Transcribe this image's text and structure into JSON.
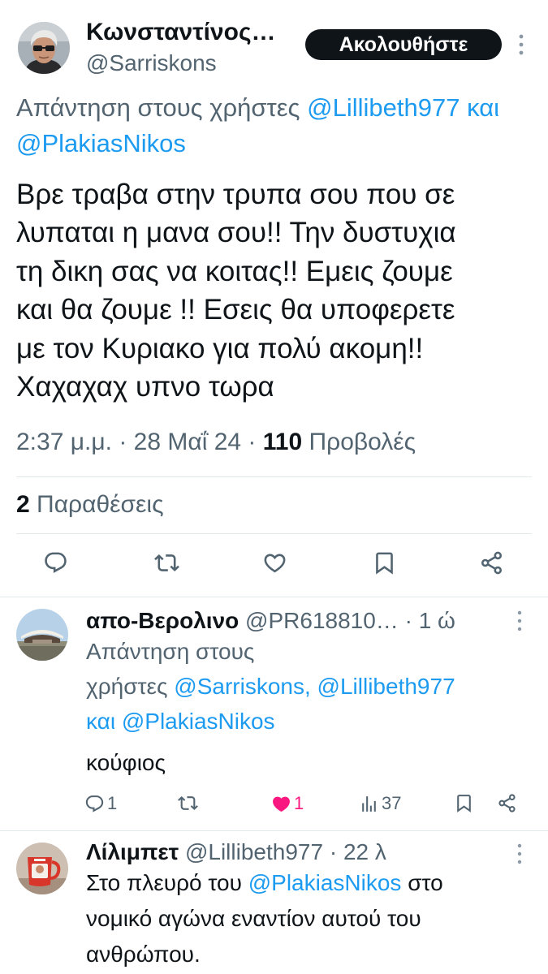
{
  "theme": {
    "text": "#0f1419",
    "secondary": "#536471",
    "link": "#1d9bf0",
    "like": "#f91880",
    "divider": "#e3e8eb",
    "follow_button_bg": "#0f1419"
  },
  "main_tweet": {
    "author": {
      "name": "Κωνσταντίνος…",
      "handle": "@Sarriskons",
      "avatar_icon": "avatar-photo"
    },
    "follow_button": "Ακολουθήστε",
    "more_icon": "more-vertical-icon",
    "reply_to": {
      "prefix": "Απάντηση στους χρήστες",
      "mention_1": "@Lillibeth977",
      "conjunction": "και",
      "mention_2": "@PlakiasNikos"
    },
    "text_lines": [
      "Βρε τραβα στην τρυπα σου που σε",
      "λυπαται η μανα σου!! Την δυστυχια",
      "τη δικη σας να κοιτας!! Εμεις ζουμε",
      "και θα ζουμε !! Εσεις θα υποφερετε",
      "με τον Κυριακο για πολύ ακομη!!",
      "Χαχαχαχ υπνο τωρα"
    ],
    "meta": {
      "time": "2:37 μ.μ.",
      "separator": "·",
      "date": "28 Μαΐ 24",
      "views_count": "110",
      "views_label": "Προβολές"
    },
    "quotes": {
      "count": "2",
      "label": "Παραθέσεις"
    },
    "actions": [
      {
        "icon": "reply-icon"
      },
      {
        "icon": "retweet-icon"
      },
      {
        "icon": "like-icon"
      },
      {
        "icon": "bookmark-icon"
      },
      {
        "icon": "share-icon"
      }
    ]
  },
  "replies": [
    {
      "name": "απο-Βερολινο",
      "handle": "@PR618810…",
      "separator": "·",
      "time": "1 ώ",
      "avatar_icon": "avatar-landscape",
      "reply_to": {
        "line1": "Απάντηση στους",
        "line2_prefix": "χρήστες",
        "mention_1": "@Sarriskons",
        "comma": ",",
        "mention_2": "@Lillibeth977",
        "conjunction": "και",
        "mention_3": "@PlakiasNikos"
      },
      "text": "κούφιος",
      "metrics": {
        "replies": "1",
        "likes": "1",
        "liked": true,
        "views": "37"
      }
    },
    {
      "name": "Λίλιμπετ",
      "handle": "@Lillibeth977",
      "separator": "·",
      "time": "22 λ",
      "avatar_icon": "avatar-mug",
      "text": {
        "line1_before": "Στο πλευρό του",
        "mention": "@PlakiasNikos",
        "line1_after": "στο",
        "line2": "νομικό αγώνα εναντίον αυτού του",
        "line3": "ανθρώπου."
      }
    }
  ]
}
